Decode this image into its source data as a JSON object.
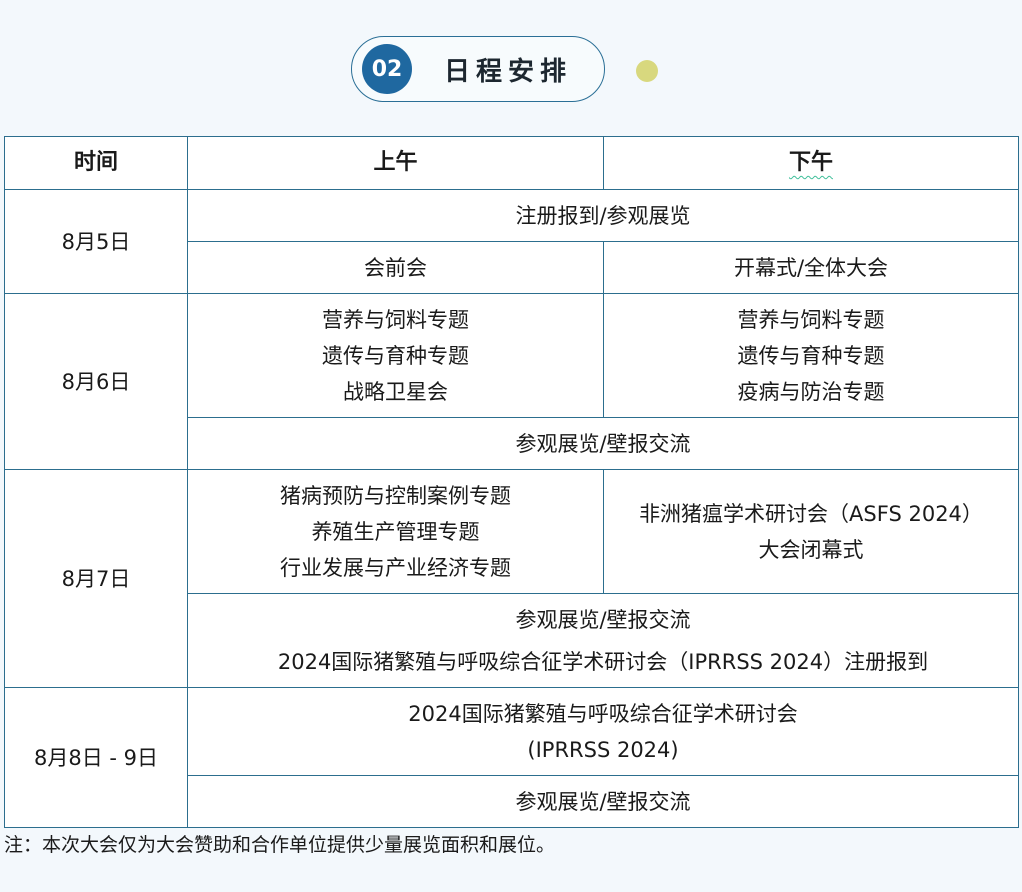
{
  "section": {
    "number": "02",
    "title": "日程安排"
  },
  "colors": {
    "border": "#2c6e8e",
    "circle": "#1f68a0",
    "dot": "#d8d87e",
    "background": "#f3f8fc"
  },
  "table": {
    "headers": {
      "time": "时间",
      "morning": "上午",
      "afternoon": "下午"
    },
    "aug5": {
      "date": "8月5日",
      "full": "注册报到/参观展览",
      "morning": "会前会",
      "afternoon": "开幕式/全体大会"
    },
    "aug6": {
      "date": "8月6日",
      "morning": [
        "营养与饲料专题",
        "遗传与育种专题",
        "战略卫星会"
      ],
      "afternoon": [
        "营养与饲料专题",
        "遗传与育种专题",
        "疫病与防治专题"
      ],
      "full": "参观展览/壁报交流"
    },
    "aug7": {
      "date": "8月7日",
      "morning": [
        "猪病预防与控制案例专题",
        "养殖生产管理专题",
        "行业发展与产业经济专题"
      ],
      "afternoon": [
        "非洲猪瘟学术研讨会（ASFS 2024）",
        "大会闭幕式"
      ],
      "full": [
        "参观展览/壁报交流",
        "2024国际猪繁殖与呼吸综合征学术研讨会（IPRRSS 2024）注册报到"
      ]
    },
    "aug8_9": {
      "date": "8月8日 - 9日",
      "main": [
        "2024国际猪繁殖与呼吸综合征学术研讨会",
        "(IPRRSS 2024)"
      ],
      "full": "参观展览/壁报交流"
    }
  },
  "note": "注：本次大会仅为大会赞助和合作单位提供少量展览面积和展位。"
}
